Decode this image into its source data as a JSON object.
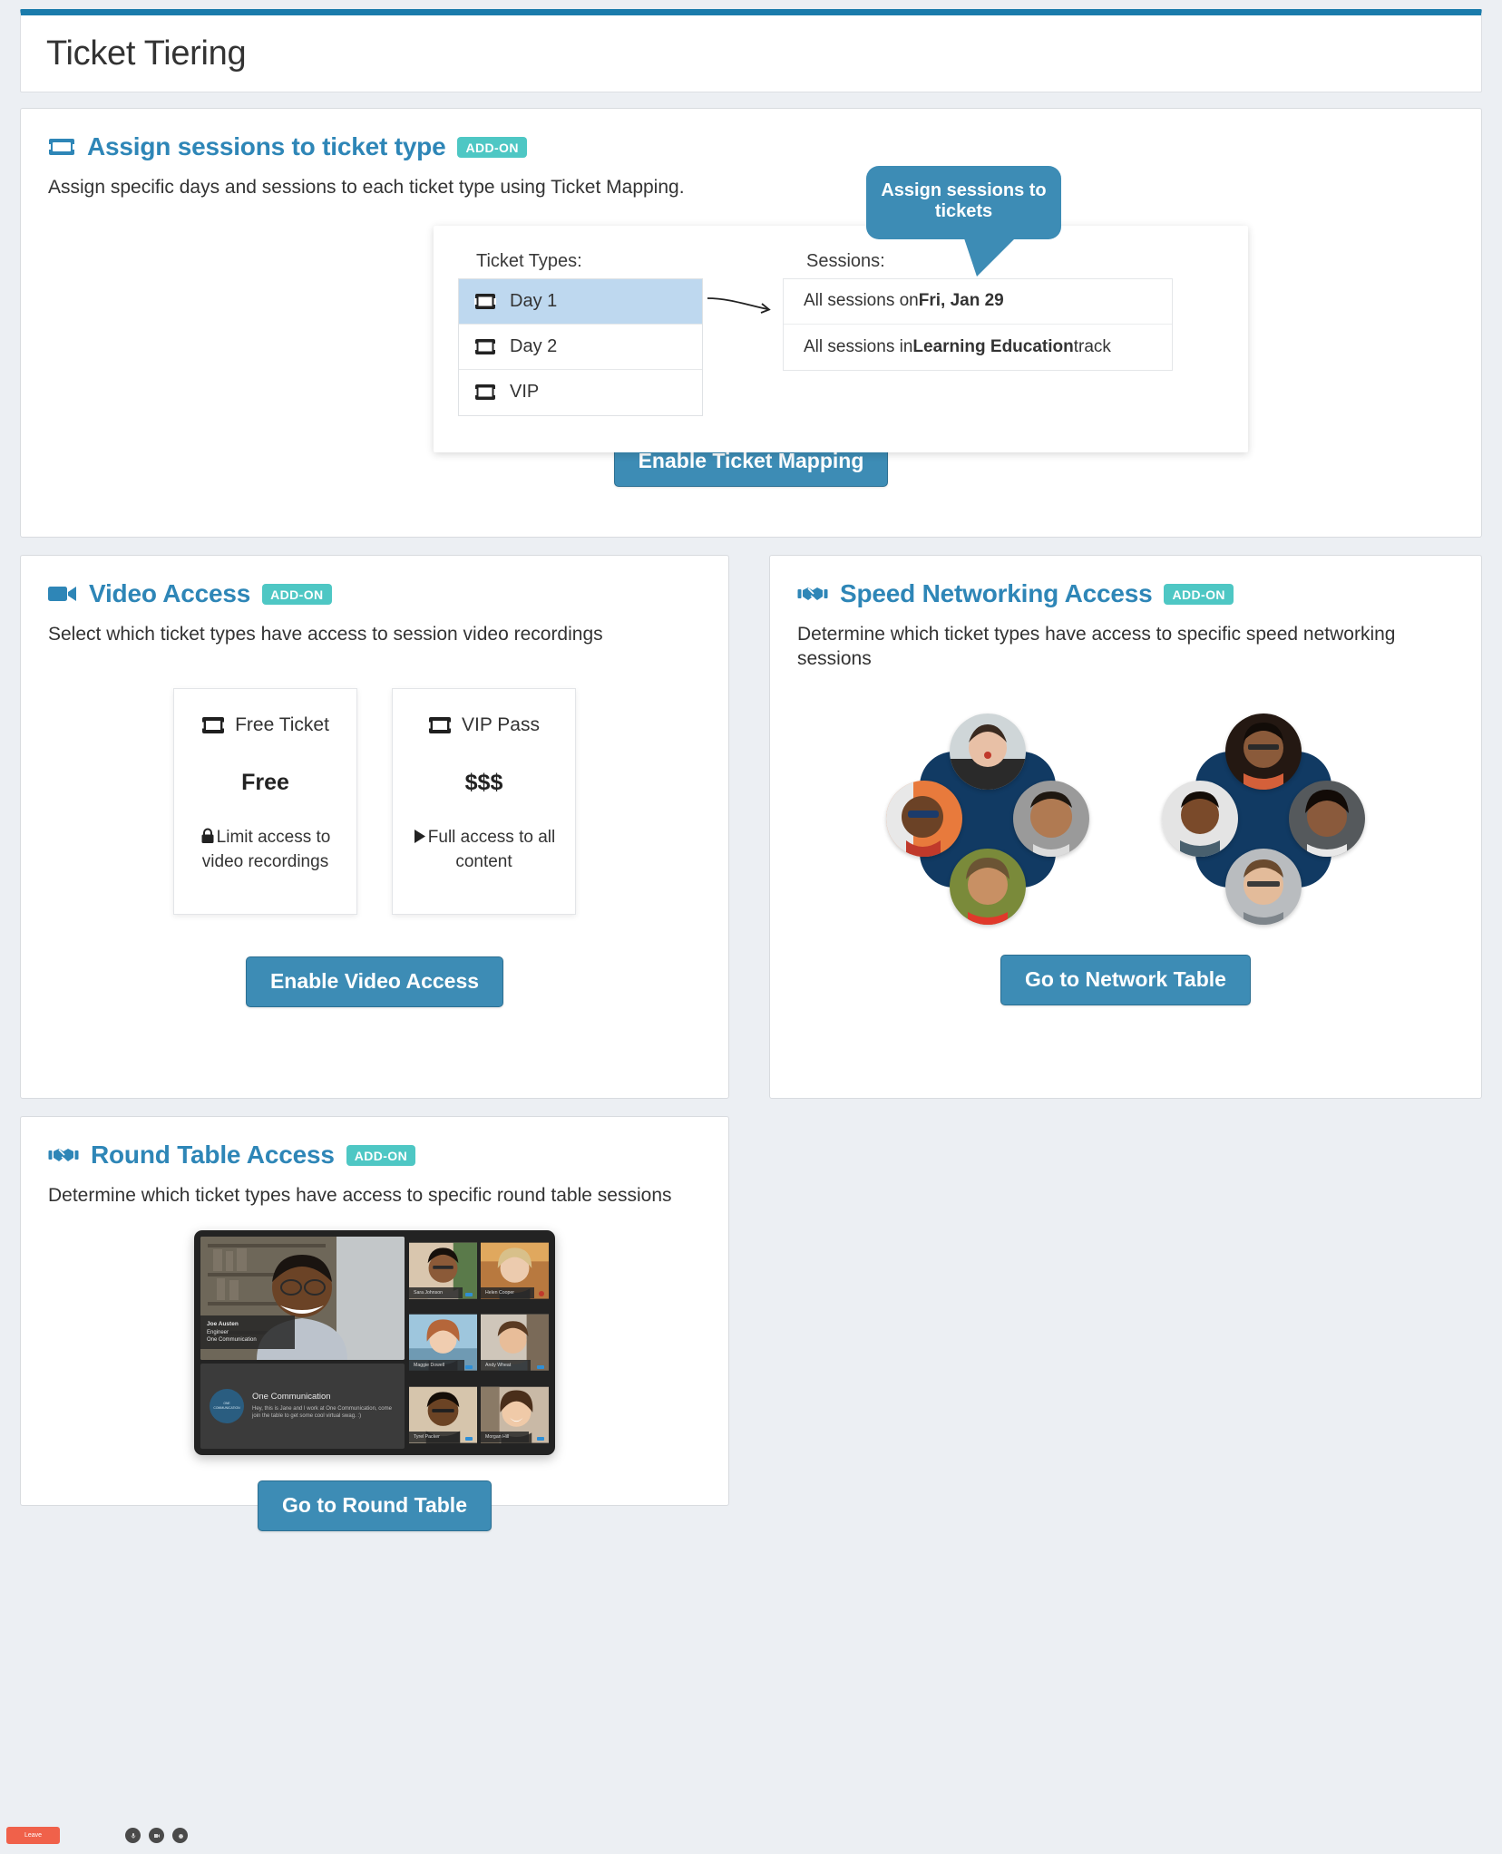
{
  "page": {
    "title": "Ticket Tiering",
    "accent": "#1a7bab",
    "badge_color": "#4ec7c4",
    "button_color": "#3d8cb5"
  },
  "assign_section": {
    "title": "Assign sessions to ticket type",
    "badge": "ADD-ON",
    "description": "Assign specific days and sessions to each ticket type using Ticket Mapping.",
    "diagram": {
      "ticket_types_label": "Ticket Types:",
      "sessions_label": "Sessions:",
      "ticket_types": [
        {
          "label": "Day 1",
          "selected": true
        },
        {
          "label": "Day 2",
          "selected": false
        },
        {
          "label": "VIP",
          "selected": false
        }
      ],
      "sessions": [
        {
          "prefix": "All sessions on ",
          "bold": "Fri, Jan 29",
          "suffix": ""
        },
        {
          "prefix": "All sessions in ",
          "bold": "Learning Education",
          "suffix": " track"
        }
      ],
      "callout": "Assign sessions to tickets"
    },
    "button": "Enable Ticket Mapping"
  },
  "video_section": {
    "title": "Video Access",
    "badge": "ADD-ON",
    "description": "Select which ticket types have access to session video recordings",
    "tickets": [
      {
        "name": "Free Ticket",
        "price": "Free",
        "note": "Limit access to video recordings",
        "icon": "lock-icon"
      },
      {
        "name": "VIP Pass",
        "price": "$$$",
        "note": "Full access to all content",
        "icon": "play-icon"
      }
    ],
    "button": "Enable Video Access"
  },
  "speed_section": {
    "title": "Speed Networking Access",
    "badge": "ADD-ON",
    "description": "Determine which ticket types have access to specific speed networking sessions",
    "button": "Go to Network Table"
  },
  "round_section": {
    "title": "Round Table Access",
    "badge": "ADD-ON",
    "description": "Determine which ticket types have access to specific round table sessions",
    "button": "Go to Round Table",
    "video_call": {
      "host": {
        "name": "Joe Austen",
        "role": "Engineer",
        "company": "One Communication"
      },
      "chat": {
        "title": "One Communication",
        "message": "Hey, this is Jane and I work at One Communication, come join the table to get some cool virtual swag. :)"
      },
      "participants": [
        "Sara Johnson",
        "Helen Cooper",
        "Maggie Dowell",
        "Andy Wheat",
        "Tyrel Packer",
        "Morgan Hill"
      ],
      "leave_label": "Leave"
    }
  }
}
